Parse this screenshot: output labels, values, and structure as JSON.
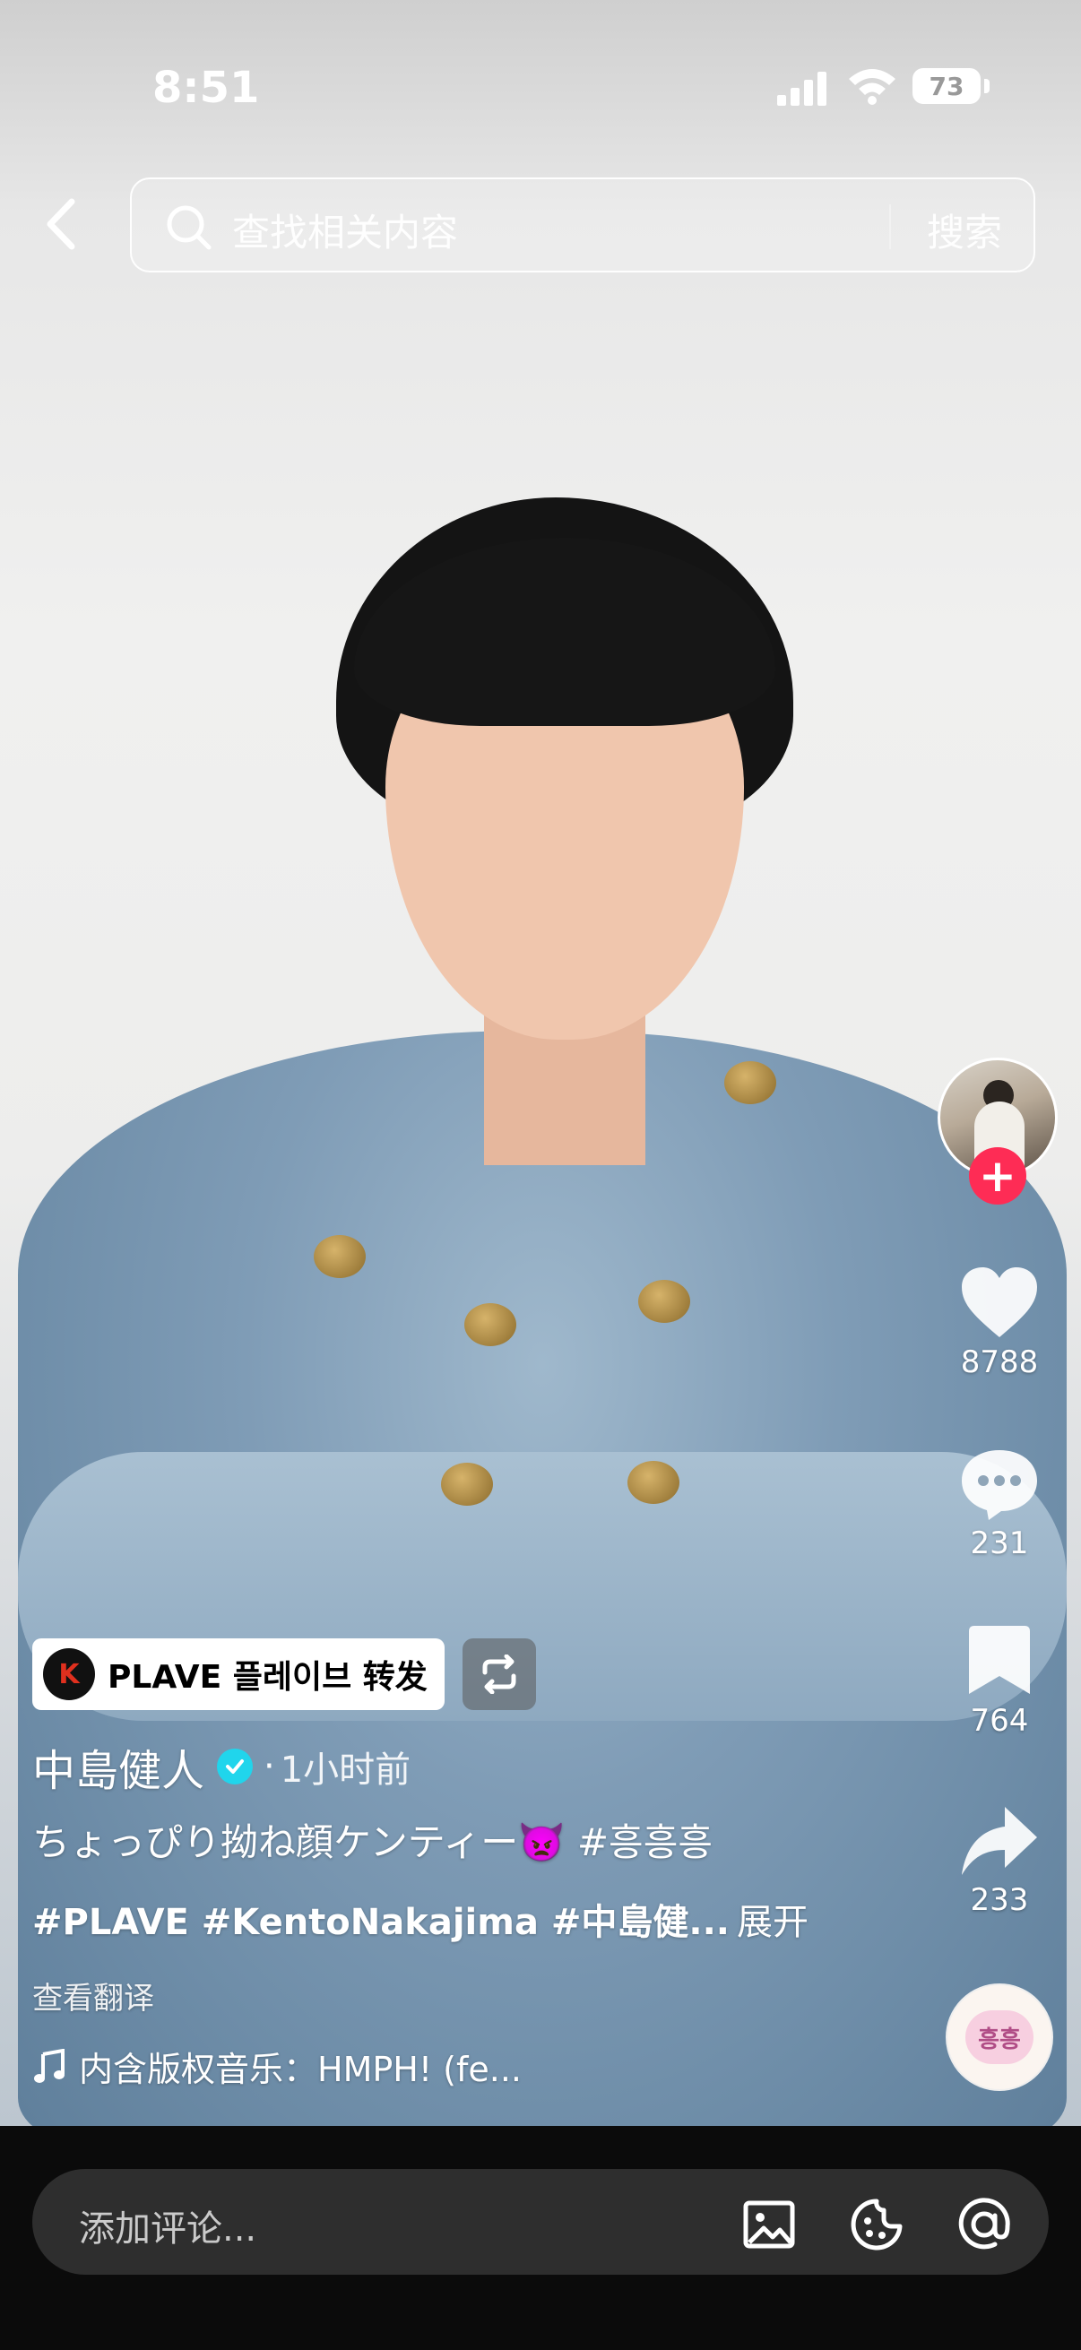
{
  "status_bar": {
    "time": "8:51",
    "battery": "73"
  },
  "search": {
    "placeholder": "查找相关内容",
    "button_label": "搜索"
  },
  "sidebar_actions": {
    "likes": "8788",
    "comments": "231",
    "favorites": "764",
    "shares": "233"
  },
  "post": {
    "repost_label": "PLAVE 플레이브 转发",
    "repost_logo_text": "K",
    "author": "中島健人",
    "author_separator": "·",
    "time_ago": "1小时前",
    "caption_line1": "ちょっぴり拗ね顔ケンティー👿 #흥흥흥",
    "caption_line2": "#PLAVE #KentoNakajima #中島健...",
    "expand_label": "展开",
    "translate_label": "查看翻译",
    "music": "内含版权音乐：HMPH! (fe..."
  },
  "music_disc_text": "흥흥",
  "comment_bar": {
    "placeholder": "添加评论..."
  },
  "colors": {
    "follow_red": "#fe2c55",
    "verified_blue": "#20d5ec",
    "bottom_bar": "#0b0b0b"
  },
  "icons": [
    "back-icon",
    "search-icon",
    "heart-icon",
    "comment-icon",
    "bookmark-icon",
    "share-icon",
    "repost-icon",
    "music-note-icon",
    "image-icon",
    "emoji-icon",
    "mention-icon"
  ]
}
